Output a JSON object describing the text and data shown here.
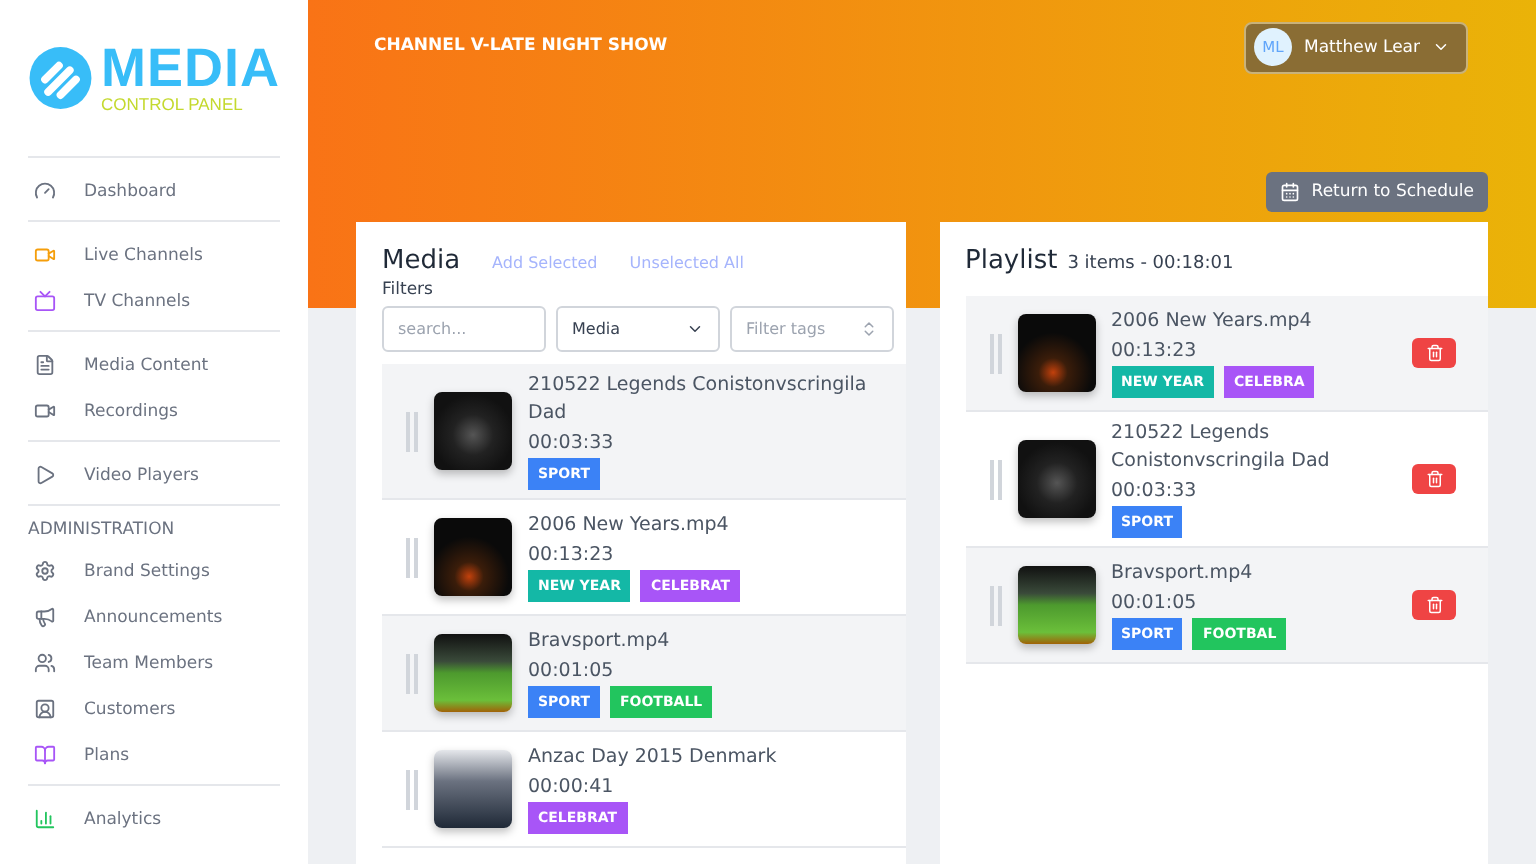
{
  "logo": {
    "title": "MEDIA",
    "subtitle": "CONTROL PANEL"
  },
  "sidebar": {
    "groups": [
      {
        "items": [
          {
            "label": "Dashboard",
            "color": "#6b7280"
          }
        ]
      },
      {
        "items": [
          {
            "label": "Live Channels",
            "color": "#f59e0b"
          },
          {
            "label": "TV Channels",
            "color": "#a855f7"
          }
        ]
      },
      {
        "items": [
          {
            "label": "Media Content",
            "color": "#6b7280"
          },
          {
            "label": "Recordings",
            "color": "#6b7280"
          }
        ]
      },
      {
        "items": [
          {
            "label": "Video Players",
            "color": "#6b7280"
          }
        ]
      },
      {
        "heading": "ADMINISTRATION",
        "items": [
          {
            "label": "Brand Settings",
            "color": "#6b7280"
          },
          {
            "label": "Announcements",
            "color": "#6b7280"
          },
          {
            "label": "Team Members",
            "color": "#6b7280"
          },
          {
            "label": "Customers",
            "color": "#6b7280"
          },
          {
            "label": "Plans",
            "color": "#a855f7"
          }
        ]
      },
      {
        "items": [
          {
            "label": "Analytics",
            "color": "#22c55e"
          }
        ]
      }
    ]
  },
  "header": {
    "title": "CHANNEL V-LATE NIGHT SHOW",
    "user": {
      "initials": "ML",
      "name": "Matthew Lear"
    },
    "return_button": "Return to Schedule"
  },
  "media": {
    "title": "Media",
    "actions": [
      "Add Selected",
      "Unselected All"
    ],
    "filters_label": "Filters",
    "search": {
      "placeholder": "search..."
    },
    "type_select": "Media",
    "tags_select": {
      "placeholder": "Filter tags"
    },
    "items": [
      {
        "name": "210522 Legends Conistonvscringila Dad",
        "duration": "00:03:33",
        "selected": true,
        "tags": [
          {
            "label": "SPORT",
            "color": "#3b82f6"
          }
        ]
      },
      {
        "name": "2006 New Years.mp4",
        "duration": "00:13:23",
        "selected": false,
        "tags": [
          {
            "label": "NEW YEAR",
            "color": "#14b8a6"
          },
          {
            "label": "CELEBRAT",
            "color": "#a855f7"
          }
        ]
      },
      {
        "name": "Bravsport.mp4",
        "duration": "00:01:05",
        "selected": true,
        "tags": [
          {
            "label": "SPORT",
            "color": "#3b82f6"
          },
          {
            "label": "FOOTBALL",
            "color": "#22c55e"
          }
        ]
      },
      {
        "name": "Anzac Day 2015 Denmark",
        "duration": "00:00:41",
        "selected": false,
        "tags": [
          {
            "label": "CELEBRAT",
            "color": "#a855f7"
          }
        ]
      }
    ]
  },
  "playlist": {
    "title": "Playlist",
    "summary": "3 items - 00:18:01",
    "items": [
      {
        "name": "2006 New Years.mp4",
        "duration": "00:13:23",
        "selected": true,
        "tags": [
          {
            "label": "NEW YEAR",
            "color": "#14b8a6"
          },
          {
            "label": "CELEBRA",
            "color": "#a855f7"
          }
        ]
      },
      {
        "name": "210522 Legends Conistonvscringila Dad",
        "duration": "00:03:33",
        "selected": false,
        "tags": [
          {
            "label": "SPORT",
            "color": "#3b82f6"
          }
        ]
      },
      {
        "name": "Bravsport.mp4",
        "duration": "00:01:05",
        "selected": true,
        "tags": [
          {
            "label": "SPORT",
            "color": "#3b82f6"
          },
          {
            "label": "FOOTBAL",
            "color": "#22c55e"
          }
        ]
      }
    ]
  }
}
